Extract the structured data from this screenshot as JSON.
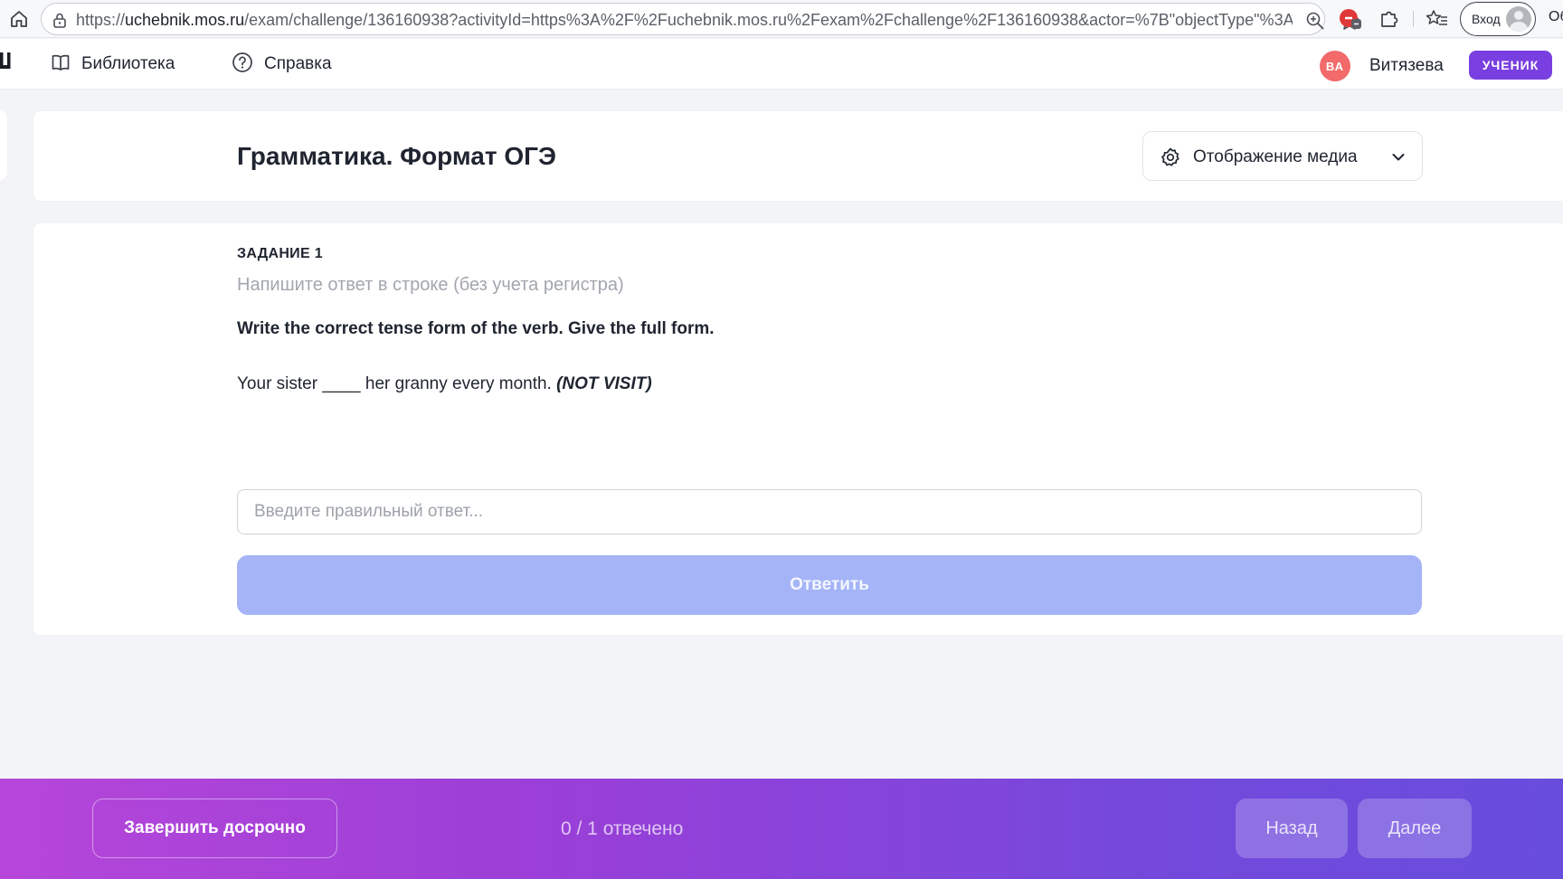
{
  "browser": {
    "url_scheme": "https://",
    "url_host": "uchebnik.mos.ru",
    "url_path": "/exam/challenge/136160938?activityId=https%3A%2F%2Fuchebnik.mos.ru%2Fexam%2Fchallenge%2F136160938&actor=%7B\"objectType\"%3A...",
    "login_label": "Вход",
    "edge_fragment": "Oб",
    "icons": [
      "home-icon",
      "lock-icon",
      "zoom-icon",
      "star-icon",
      "adblock-icon",
      "puzzle-icon",
      "favorites-icon",
      "profile-icon"
    ]
  },
  "header": {
    "nav": [
      {
        "label": "Библиотека",
        "icon": "book-icon"
      },
      {
        "label": "Справка",
        "icon": "help-circle-icon"
      }
    ],
    "user": {
      "initials": "ВА",
      "name": "Витязева",
      "role": "УЧЕНИК"
    }
  },
  "title_card": {
    "title": "Грамматика. Формат ОГЭ",
    "media_button": {
      "label": "Отображение медиа",
      "icon": "gear-icon"
    }
  },
  "task": {
    "label": "ЗАДАНИЕ 1",
    "hint": "Напишите ответ в строке (без учета регистра)",
    "instruction": "Write the correct tense form of the verb. Give the full form.",
    "sentence_text": "Your sister ____ her granny every month.",
    "sentence_cue": "(NOT VISIT)",
    "input_value": "",
    "input_placeholder": "Введите правильный ответ...",
    "submit_label": "Ответить"
  },
  "footer": {
    "finish_label": "Завершить досрочно",
    "progress": "0 / 1 отвечено",
    "back_label": "Назад",
    "next_label": "Далее"
  },
  "colors": {
    "accent_purple": "#7a3fe0",
    "avatar_red": "#f26a6a",
    "submit_disabled": "#a4b4f7",
    "footer_gradient_start": "#b646d9",
    "footer_gradient_end": "#684ddd"
  }
}
